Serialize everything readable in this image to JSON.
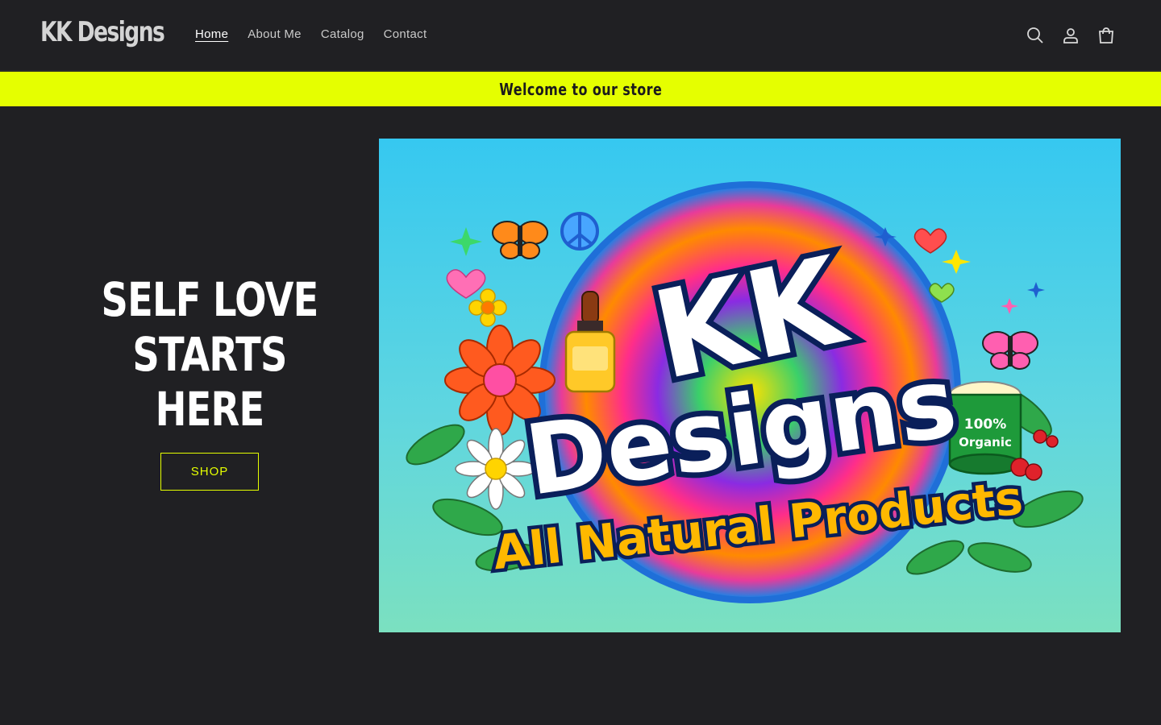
{
  "header": {
    "logo_text": "KK Designs",
    "nav": [
      {
        "label": "Home",
        "active": true
      },
      {
        "label": "About Me",
        "active": false
      },
      {
        "label": "Catalog",
        "active": false
      },
      {
        "label": "Contact",
        "active": false
      }
    ],
    "icons": [
      "search-icon",
      "account-icon",
      "cart-icon"
    ]
  },
  "announcement": {
    "text": "Welcome to our store",
    "background": "#e5ff00"
  },
  "hero": {
    "title_lines": [
      "SELF LOVE",
      "STARTS",
      "HERE"
    ],
    "button_label": "SHOP",
    "accent": "#e5ff00",
    "image": {
      "line1": "KK",
      "line2": "Designs",
      "line3": "All Natural Products",
      "badge_line1": "100%",
      "badge_line2": "Organic"
    }
  },
  "colors": {
    "page_bg": "#202023",
    "text": "#ffffff"
  }
}
